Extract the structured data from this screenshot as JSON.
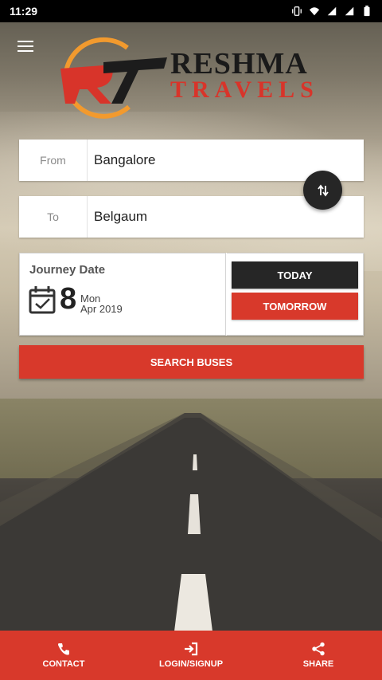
{
  "status_bar": {
    "time": "11:29"
  },
  "header": {
    "menu_icon": "hamburger-menu-icon",
    "logo_line1": "RESHMA",
    "logo_line2": "TRAVELS",
    "colors": {
      "brand_red": "#d8392b",
      "logo_orange": "#f29a2e",
      "dark": "#262626"
    }
  },
  "search_form": {
    "from_label": "From",
    "from_value": "Bangalore",
    "to_label": "To",
    "to_value": "Belgaum",
    "swap_icon": "swap-vertical-icon"
  },
  "journey_date": {
    "title": "Journey Date",
    "day": "8",
    "weekday": "Mon",
    "month_year": "Apr 2019",
    "today_label": "TODAY",
    "tomorrow_label": "TOMORROW"
  },
  "search_button_label": "SEARCH BUSES",
  "bottom_nav": {
    "items": [
      {
        "label": "CONTACT",
        "icon": "phone-icon"
      },
      {
        "label": "LOGIN/SIGNUP",
        "icon": "login-icon"
      },
      {
        "label": "SHARE",
        "icon": "share-icon"
      }
    ]
  }
}
